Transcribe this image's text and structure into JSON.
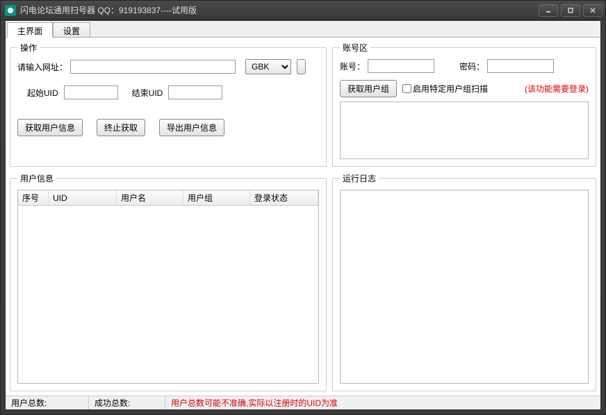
{
  "window": {
    "title": "闪电论坛通用扫号器 QQ：919193837----试用版"
  },
  "tabs": {
    "main": "主界面",
    "settings": "设置"
  },
  "operation": {
    "legend": "操作",
    "url_label": "请输入网址：",
    "url_value": "",
    "encoding": "GBK",
    "start_uid_label": "起始UID",
    "start_uid_value": "",
    "end_uid_label": "结束UID",
    "end_uid_value": "",
    "btn_get_info": "获取用户信息",
    "btn_stop": "终止获取",
    "btn_export": "导出用户信息"
  },
  "account": {
    "legend": "账号区",
    "acct_label": "账号：",
    "acct_value": "",
    "pwd_label": "密码：",
    "pwd_value": "",
    "btn_get_group": "获取用户组",
    "chk_label": "启用特定用户组扫描",
    "hint": "(该功能需要登录)"
  },
  "userinfo": {
    "legend": "用户信息",
    "cols": {
      "seq": "序号",
      "uid": "UID",
      "uname": "用户名",
      "ugroup": "用户组",
      "lstate": "登录状态"
    }
  },
  "log": {
    "legend": "运行日志"
  },
  "status": {
    "total_users": "用户总数:",
    "success_total": "成功总数:",
    "warning": "用户总数可能不准确,实际以注册时的UID为准"
  }
}
